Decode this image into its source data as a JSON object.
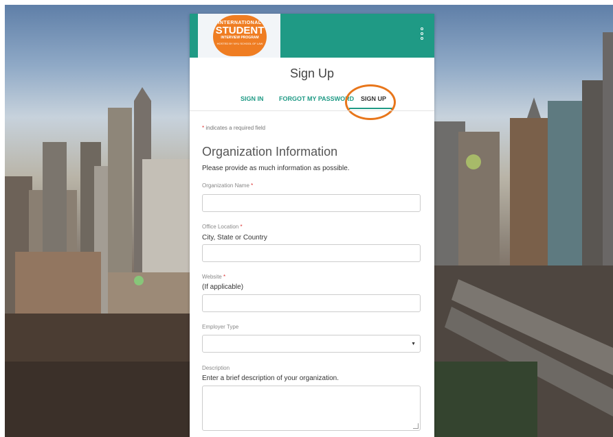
{
  "logo": {
    "line1": "INTERNATIONAL",
    "line2": "STUDENT",
    "line3": "INTERVIEW PROGRAM",
    "line4": "HOSTED BY NYU SCHOOL OF LAW"
  },
  "page_title": "Sign Up",
  "tabs": [
    {
      "label": "SIGN IN"
    },
    {
      "label": "FORGOT MY PASSWORD"
    },
    {
      "label": "SIGN UP"
    }
  ],
  "required_note": {
    "asterisk": "*",
    "text": " indicates a required field"
  },
  "section": {
    "title": "Organization Information",
    "subtitle": "Please provide as much information as possible."
  },
  "fields": {
    "organization_name": {
      "label": "Organization Name",
      "required": "*",
      "value": ""
    },
    "office_location": {
      "label": "Office Location",
      "required": "*",
      "hint": "City, State or Country",
      "value": ""
    },
    "website": {
      "label": "Website",
      "required": "*",
      "hint": "(If applicable)",
      "value": ""
    },
    "employer_type": {
      "label": "Employer Type",
      "selected": ""
    },
    "description": {
      "label": "Description",
      "hint": "Enter a brief description of your organization.",
      "value": ""
    }
  },
  "colors": {
    "header": "#1f9a85",
    "accent": "#1f9a85",
    "annotation_circle": "#e8761b",
    "logo_badge": "#ef7d22"
  },
  "icons": {
    "menu": "kebab-menu-icon",
    "select": "caret-down-icon"
  }
}
